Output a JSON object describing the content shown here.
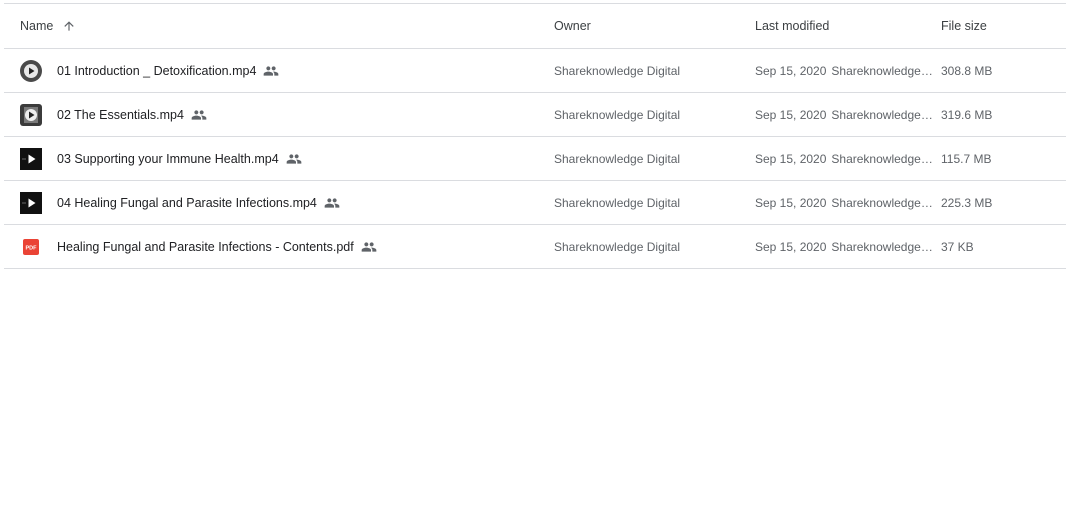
{
  "columns": {
    "name": "Name",
    "owner": "Owner",
    "last_modified": "Last modified",
    "file_size": "File size"
  },
  "sort": {
    "column": "Name",
    "direction": "ascending",
    "icon": "arrow-up-icon"
  },
  "files": [
    {
      "name": "01 Introduction _ Detoxification.mp4",
      "type": "video",
      "icon": "video-thumbnail-icon",
      "shared": true,
      "owner": "Shareknowledge Digital",
      "modified_date": "Sep 15, 2020",
      "modified_by": "Shareknowledge …",
      "size": "308.8 MB"
    },
    {
      "name": "02 The Essentials.mp4",
      "type": "video",
      "icon": "video-thumbnail-icon",
      "shared": true,
      "owner": "Shareknowledge Digital",
      "modified_date": "Sep 15, 2020",
      "modified_by": "Shareknowledge …",
      "size": "319.6 MB"
    },
    {
      "name": "03 Supporting your Immune Health.mp4",
      "type": "video",
      "icon": "video-thumbnail-icon",
      "shared": true,
      "owner": "Shareknowledge Digital",
      "modified_date": "Sep 15, 2020",
      "modified_by": "Shareknowledge …",
      "size": "115.7 MB"
    },
    {
      "name": "04 Healing Fungal and Parasite Infections.mp4",
      "type": "video",
      "icon": "video-thumbnail-icon",
      "shared": true,
      "owner": "Shareknowledge Digital",
      "modified_date": "Sep 15, 2020",
      "modified_by": "Shareknowledge …",
      "size": "225.3 MB"
    },
    {
      "name": "Healing Fungal and Parasite Infections - Contents.pdf",
      "type": "pdf",
      "icon": "pdf-icon",
      "icon_label": "PDF",
      "shared": true,
      "owner": "Shareknowledge Digital",
      "modified_date": "Sep 15, 2020",
      "modified_by": "Shareknowledge …",
      "size": "37 KB"
    }
  ],
  "colors": {
    "pdf_red": "#ea4335",
    "divider": "#dadce0",
    "text_primary": "#202124",
    "text_secondary": "#5f6368"
  }
}
